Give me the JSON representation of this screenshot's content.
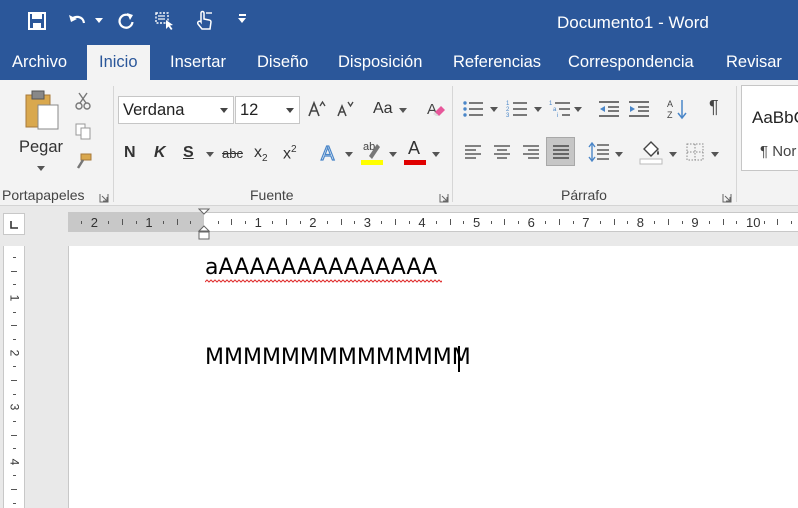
{
  "window": {
    "title": "Documento1 - Word",
    "titlebar_color": "#2b579a"
  },
  "quick_access": {
    "icons": [
      "save-icon",
      "undo-icon",
      "redo-icon",
      "select-icon",
      "touch-mode-icon",
      "customize-icon"
    ]
  },
  "ribbon_tabs": [
    {
      "label": "Archivo"
    },
    {
      "label": "Inicio",
      "active": true
    },
    {
      "label": "Insertar"
    },
    {
      "label": "Diseño"
    },
    {
      "label": "Disposición"
    },
    {
      "label": "Referencias"
    },
    {
      "label": "Correspondencia"
    },
    {
      "label": "Revisar"
    }
  ],
  "clipboard": {
    "paste_label": "Pegar",
    "group_label": "Portapapeles"
  },
  "font": {
    "font_name": "Verdana",
    "font_size": "12",
    "case_label": "Aa",
    "bold": "N",
    "italic": "K",
    "underline": "S",
    "strike": "abc",
    "subscript": "x",
    "subscript_mark": "2",
    "superscript": "x",
    "superscript_mark": "2",
    "font_color_letter": "A",
    "highlight_color": "#ffff00",
    "font_color": "#e00000",
    "group_label": "Fuente"
  },
  "paragraph": {
    "group_label": "Párrafo",
    "pilcrow": "¶"
  },
  "styles": {
    "preview_text": "AaBbC",
    "style_name": "¶ Nor"
  },
  "ruler": {
    "labels": [
      "2",
      "1",
      "1",
      "2",
      "3",
      "4",
      "5",
      "6",
      "7",
      "8",
      "9",
      "10"
    ]
  },
  "vruler": {
    "labels": [
      "1",
      "1",
      "2",
      "3",
      "4"
    ]
  },
  "document": {
    "line1": "aAAAAAAAAAAAAAA",
    "line2": "MMMMMMMMMMMMMM"
  }
}
